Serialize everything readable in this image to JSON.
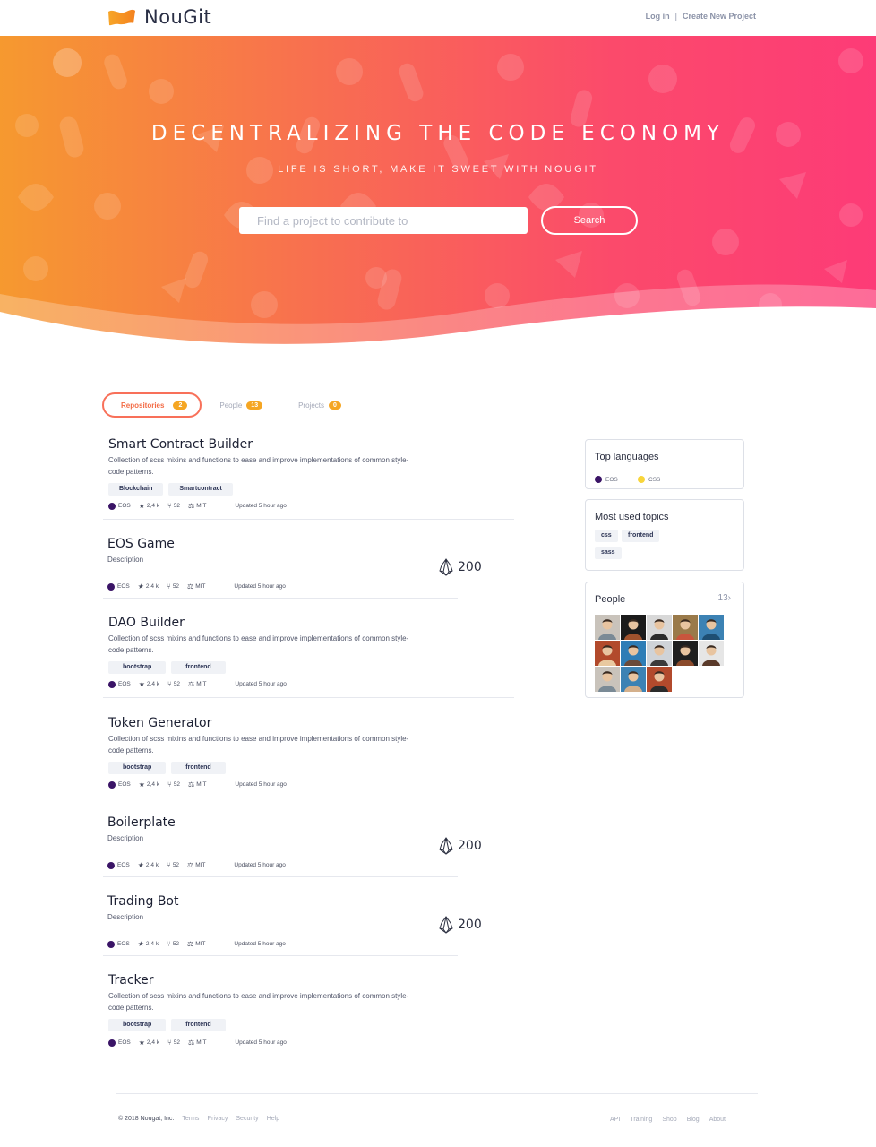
{
  "brand": {
    "name": "NouGit"
  },
  "nav": {
    "login": "Log in",
    "separator": "|",
    "create": "Create New Project"
  },
  "hero": {
    "title": "DECENTRALIZING THE CODE ECONOMY",
    "subtitle": "LIFE IS SHORT, MAKE IT SWEET WITH NOUGIT",
    "search_placeholder": "Find a project to contribute to",
    "search_button": "Search"
  },
  "tabs": [
    {
      "label": "Repositories",
      "count": "2",
      "active": true
    },
    {
      "label": "People",
      "count": "13",
      "active": false
    },
    {
      "label": "Projects",
      "count": "0",
      "active": false
    }
  ],
  "repos": [
    {
      "name": "Smart Contract Builder",
      "description": "Collection of scss mixins and functions to ease and improve implementations of common style-code patterns.",
      "tags": [
        "Blockchain",
        "Smartcontract"
      ],
      "language": "EOS",
      "stars": "2,4 k",
      "forks": "52",
      "license": "MIT",
      "updated": "Updated 5 hour ago"
    },
    {
      "name": "EOS Game",
      "description": "Description",
      "language": "EOS",
      "stars": "2,4 k",
      "forks": "52",
      "license": "MIT",
      "updated": "Updated 5 hour ago",
      "eos_amount": "200"
    },
    {
      "name": "DAO Builder",
      "description": "Collection of scss mixins and functions to ease and improve implementations of common style-code patterns.",
      "tags": [
        "bootstrap",
        "frontend"
      ],
      "language": "EOS",
      "stars": "2,4 k",
      "forks": "52",
      "license": "MIT",
      "updated": "Updated 5 hour ago"
    },
    {
      "name": "Token Generator",
      "description": "Collection of scss mixins and functions to ease and improve implementations of common style-code patterns.",
      "tags": [
        "bootstrap",
        "frontend"
      ],
      "language": "EOS",
      "stars": "2,4 k",
      "forks": "52",
      "license": "MIT",
      "updated": "Updated 5 hour ago"
    },
    {
      "name": "Boilerplate",
      "description": "Description",
      "language": "EOS",
      "stars": "2,4 k",
      "forks": "52",
      "license": "MIT",
      "updated": "Updated 5 hour ago",
      "eos_amount": "200"
    },
    {
      "name": "Trading Bot",
      "description": "Description",
      "language": "EOS",
      "stars": "2,4 k",
      "forks": "52",
      "license": "MIT",
      "updated": "Updated 5 hour ago",
      "eos_amount": "200"
    },
    {
      "name": "Tracker",
      "description": "Collection of scss mixins and functions to ease and improve implementations of common style-code patterns.",
      "tags": [
        "bootstrap",
        "frontend"
      ],
      "language": "EOS",
      "stars": "2,4 k",
      "forks": "52",
      "license": "MIT",
      "updated": "Updated 5 hour ago"
    }
  ],
  "sidebar": {
    "languages": {
      "title": "Top languages",
      "items": [
        {
          "name": "EOS",
          "color": "#3a1466"
        },
        {
          "name": "CSS",
          "color": "#f8d53a"
        }
      ]
    },
    "topics": {
      "title": "Most used topics",
      "items": [
        "css",
        "frontend",
        "sass"
      ]
    },
    "people": {
      "title": "People",
      "count": "13",
      "chevron": "›"
    }
  },
  "footer": {
    "copyright": "© 2018 Nougat, Inc.",
    "left_links": [
      "Terms",
      "Privacy",
      "Security",
      "Help"
    ],
    "right_links": [
      "API",
      "Training",
      "Shop",
      "Blog",
      "About"
    ]
  },
  "colors": {
    "accent": "#f36b45",
    "gradient_start": "#f6992f",
    "gradient_end": "#fd3b77",
    "badge": "#f5a623",
    "eos_dot": "#3a1466"
  },
  "icons": {
    "logo": "nougat-bar-logo",
    "star": "star-icon",
    "fork": "fork-icon",
    "license": "balance-scale-icon",
    "eos": "eos-token-icon",
    "chevron": "chevron-right-icon"
  }
}
